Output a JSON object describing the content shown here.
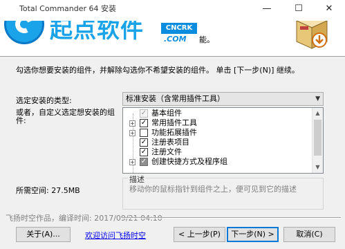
{
  "window": {
    "title": "Total Commander 64 安装",
    "min_glyph": "—",
    "max_glyph": "☐",
    "close_glyph": "✕"
  },
  "header": {
    "logo_text": "起点软件",
    "badge_text": "CNCRK",
    "badge_domain": ".COM",
    "tail_text": "能。"
  },
  "instruction": "勾选你想要安装的组件，并解除勾选你不希望安装的组件。 单击 [下一步(N)] 继续。",
  "install_type": {
    "label": "选定安装的类型:",
    "selected": "标准安装（含常用插件工具）",
    "arrow": "▼"
  },
  "custom_label": "或者，自定义选定想安装的组件:",
  "components": [
    {
      "label": "基本组件",
      "expander": "",
      "check": "✓",
      "state": "disabled"
    },
    {
      "label": "常用插件工具",
      "expander": "+",
      "check": "✓",
      "state": "checked"
    },
    {
      "label": "功能拓展插件",
      "expander": "+",
      "check": "",
      "state": "unchecked"
    },
    {
      "label": "注册表项目",
      "expander": "",
      "check": "✓",
      "state": "checked"
    },
    {
      "label": "注册文件",
      "expander": "",
      "check": "✓",
      "state": "checked"
    },
    {
      "label": "创建快捷方式及程序组",
      "expander": "+",
      "check": "✓",
      "state": "gray"
    }
  ],
  "scroll": {
    "up": "▲",
    "down": "▼"
  },
  "space_required": "所需空间: 27.5MB",
  "description": {
    "legend": "描述",
    "text": "移动你的鼠标指针到组件之上，便可见到它的描述"
  },
  "branding": "飞扬时空作品，编译时间: 2017/09/21 04:10",
  "buttons": {
    "about": "关于(A)...",
    "link": "欢迎访问飞扬时空",
    "back": "< 上一步(P)",
    "next": "下一步(N) >",
    "cancel": "取消(C)"
  },
  "colors": {
    "accent": "#0078d7",
    "logo_blue": "#1aa3e8",
    "link": "#0000ee"
  }
}
